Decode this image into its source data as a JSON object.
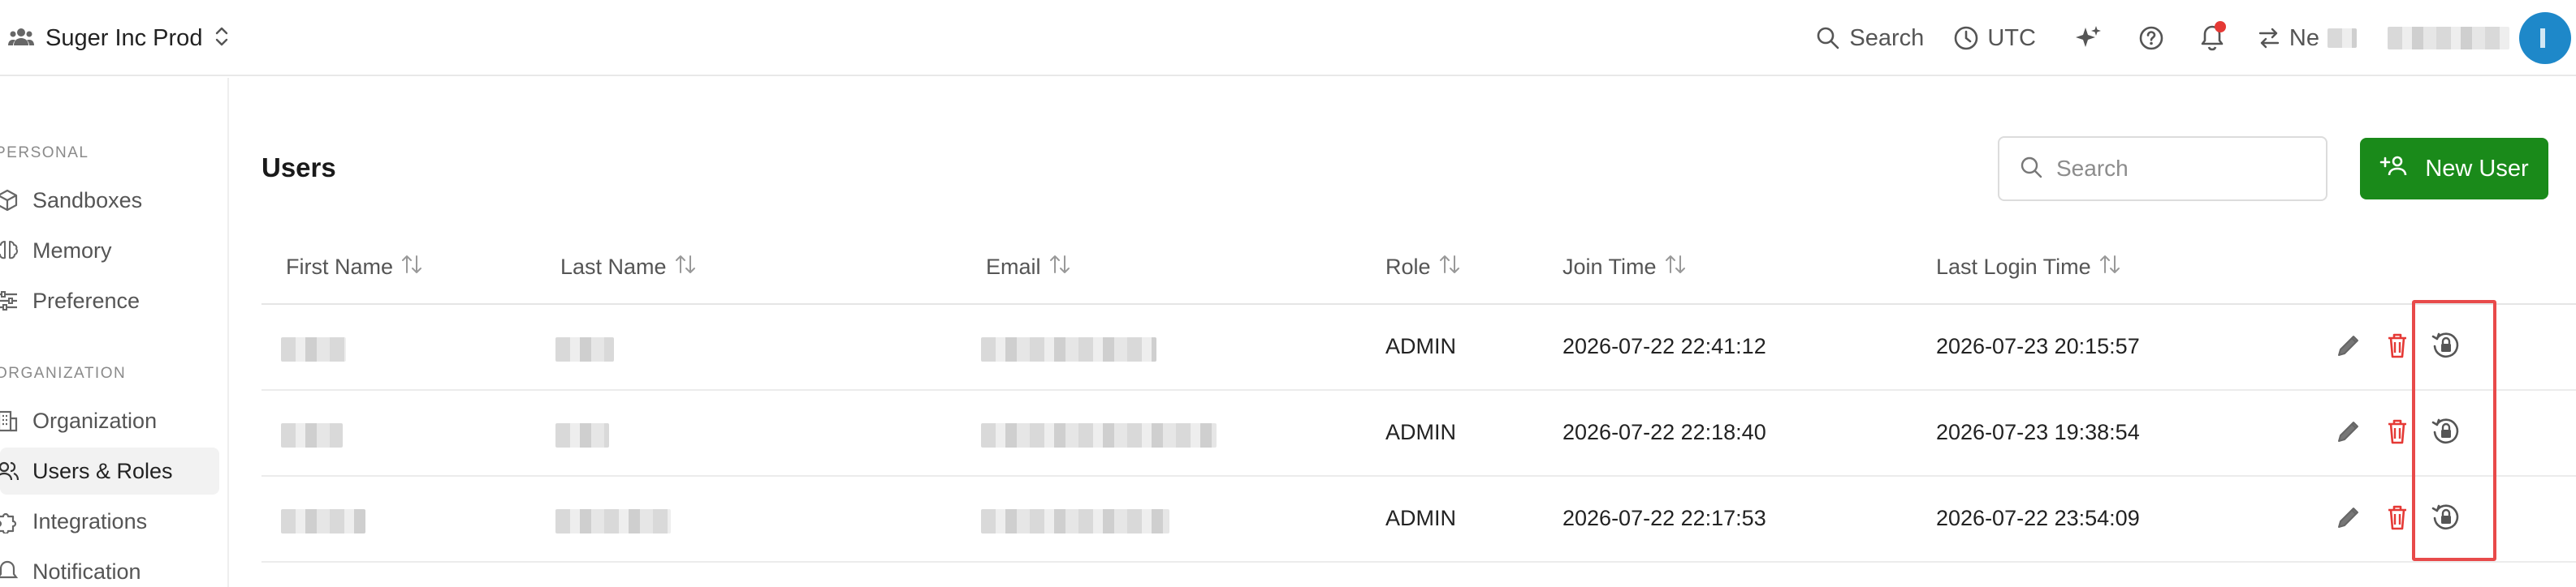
{
  "topbar": {
    "org_name": "Suger Inc Prod",
    "search_label": "Search",
    "timezone_label": "UTC",
    "network_label": "Ne",
    "notification_dot_color": "#e53935"
  },
  "sidebar": {
    "personal_label": "PERSONAL",
    "personal_items": [
      {
        "label": "Sandboxes",
        "icon": "cube-icon"
      },
      {
        "label": "Memory",
        "icon": "brain-icon"
      },
      {
        "label": "Preference",
        "icon": "sliders-icon"
      }
    ],
    "organization_label": "ORGANIZATION",
    "org_items": [
      {
        "label": "Organization",
        "icon": "building-icon"
      },
      {
        "label": "Users & Roles",
        "icon": "users-icon",
        "active": true
      },
      {
        "label": "Integrations",
        "icon": "puzzle-icon"
      },
      {
        "label": "Notification",
        "icon": "bell-icon"
      }
    ]
  },
  "main": {
    "title": "Users",
    "search_placeholder": "Search",
    "new_user_label": "New User",
    "accent_color": "#1a8a1a",
    "columns": [
      "First Name",
      "Last Name",
      "Email",
      "Role",
      "Join Time",
      "Last Login Time"
    ],
    "rows": [
      {
        "role": "ADMIN",
        "join_time": "2026-07-22 22:41:12",
        "last_login": "2026-07-23 20:15:57"
      },
      {
        "role": "ADMIN",
        "join_time": "2026-07-22 22:18:40",
        "last_login": "2026-07-23 19:38:54"
      },
      {
        "role": "ADMIN",
        "join_time": "2026-07-22 22:17:53",
        "last_login": "2026-07-22 23:54:09"
      }
    ],
    "action_icons": [
      "edit-icon",
      "delete-icon",
      "reset-password-icon"
    ],
    "delete_color": "#e53935",
    "highlight_color": "#e84a4a"
  }
}
